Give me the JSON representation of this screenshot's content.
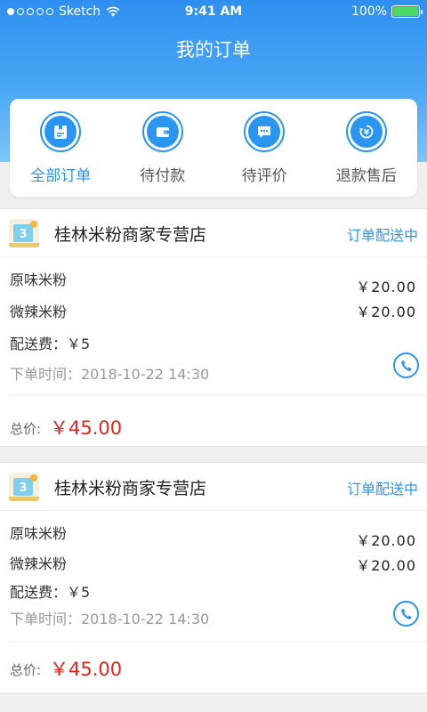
{
  "status_bar": {
    "carrier": "Sketch",
    "time": "9:41 AM",
    "battery": "100%"
  },
  "page": {
    "title": "我的订单"
  },
  "tabs": [
    {
      "label": "全部订单",
      "icon": "box-icon",
      "active": true
    },
    {
      "label": "待付款",
      "icon": "wallet-icon",
      "active": false
    },
    {
      "label": "待评价",
      "icon": "chat-bubble-icon",
      "active": false
    },
    {
      "label": "退款售后",
      "icon": "refund-icon",
      "active": false
    }
  ],
  "orders": [
    {
      "shop_name": "桂林米粉商家专营店",
      "status": "订单配送中",
      "items": [
        {
          "name": "原味米粉",
          "price": "￥20.00"
        },
        {
          "name": "微辣米粉",
          "price": "￥20.00"
        }
      ],
      "delivery_fee": "配送费：￥5",
      "order_time": "下单时间：2018-10-22  14:30",
      "total_label": "总价:",
      "total_value": "￥45.00"
    },
    {
      "shop_name": "桂林米粉商家专营店",
      "status": "订单配送中",
      "items": [
        {
          "name": "原味米粉",
          "price": "￥20.00"
        },
        {
          "name": "微辣米粉",
          "price": "￥20.00"
        }
      ],
      "delivery_fee": "配送费：￥5",
      "order_time": "下单时间：2018-10-22  14:30",
      "total_label": "总价:",
      "total_value": "￥45.00"
    }
  ],
  "colors": {
    "accent": "#2b96f1",
    "price_red": "#e8231a",
    "header_top": "#2f8ff0",
    "header_bottom": "#7cc4fb"
  }
}
